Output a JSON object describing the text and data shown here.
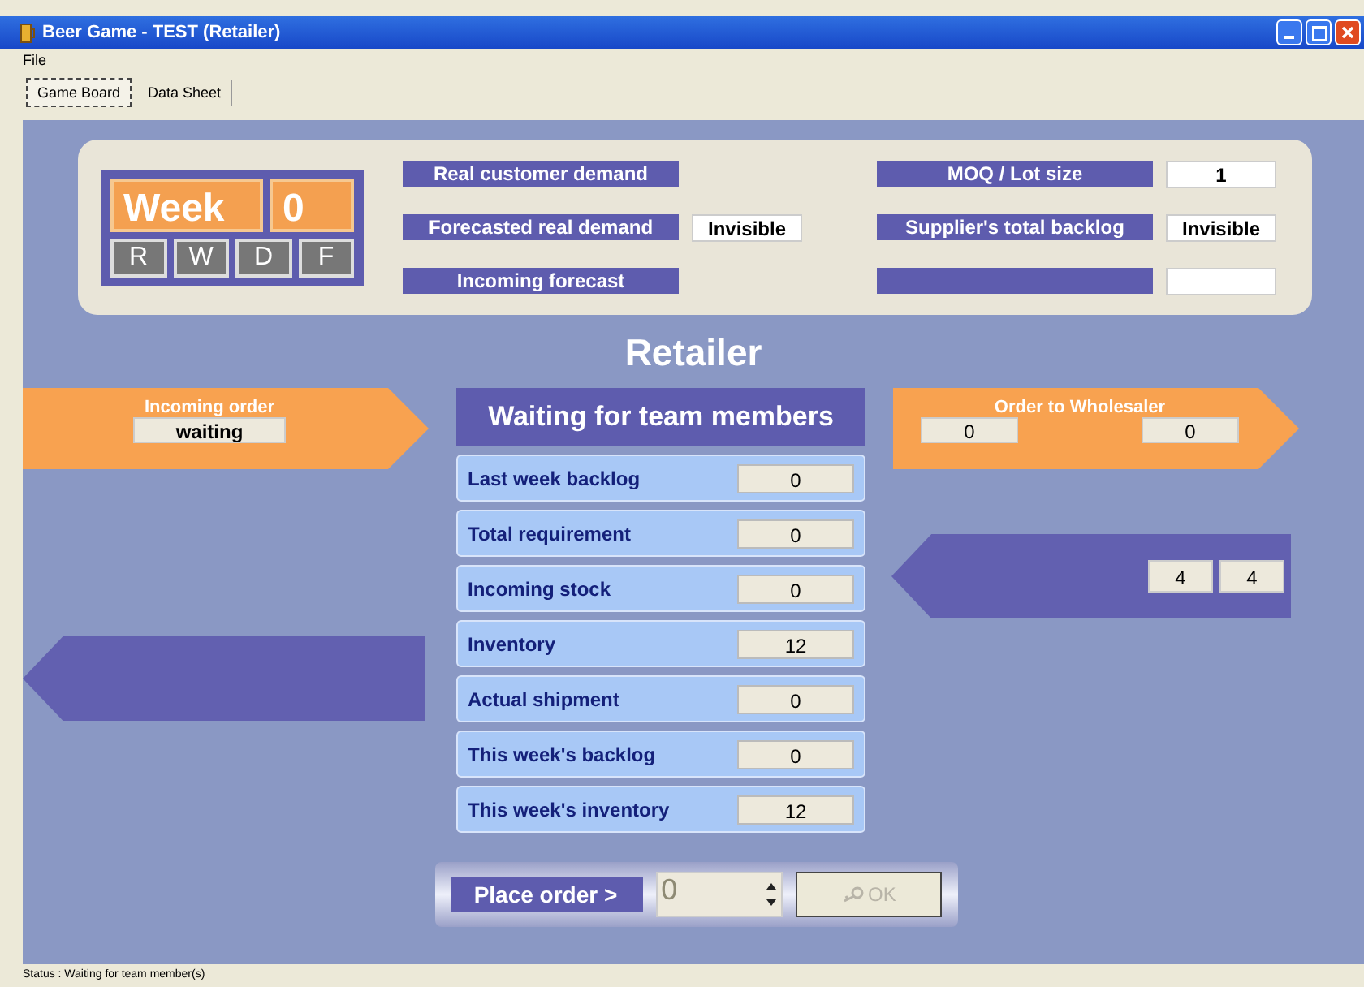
{
  "window": {
    "title": "Beer Game - TEST (Retailer)"
  },
  "menu": [
    "File"
  ],
  "tabs": [
    {
      "label": "Game Board",
      "selected": true
    },
    {
      "label": "Data Sheet",
      "selected": false
    }
  ],
  "week": {
    "label": "Week",
    "value": "0",
    "roles": [
      "R",
      "W",
      "D",
      "F"
    ]
  },
  "info_left": [
    {
      "label": "Real customer demand"
    },
    {
      "label": "Forecasted real demand",
      "value": "Invisible"
    },
    {
      "label": "Incoming forecast"
    }
  ],
  "info_right": [
    {
      "label": "MOQ / Lot size",
      "value": "1"
    },
    {
      "label": "Supplier's total backlog",
      "value": "Invisible"
    }
  ],
  "role_title": "Retailer",
  "incoming_order": {
    "label": "Incoming order",
    "value": "waiting"
  },
  "order_to": {
    "label": "Order to Wholesaler",
    "values": [
      "0",
      "0"
    ]
  },
  "incoming_shipment": {
    "values": [
      "4",
      "4"
    ]
  },
  "status_heading": "Waiting for team members",
  "rows": [
    {
      "label": "Last week backlog",
      "value": "0"
    },
    {
      "label": "Total requirement",
      "value": "0"
    },
    {
      "label": "Incoming stock",
      "value": "0"
    },
    {
      "label": "Inventory",
      "value": "12"
    },
    {
      "label": "Actual shipment",
      "value": "0"
    },
    {
      "label": "This week's backlog",
      "value": "0"
    },
    {
      "label": "This week's inventory",
      "value": "12"
    }
  ],
  "place_order": {
    "label": "Place order >",
    "value": "0",
    "ok": "OK",
    "disabled": true
  },
  "status_bar": "Status : Waiting for team member(s)"
}
